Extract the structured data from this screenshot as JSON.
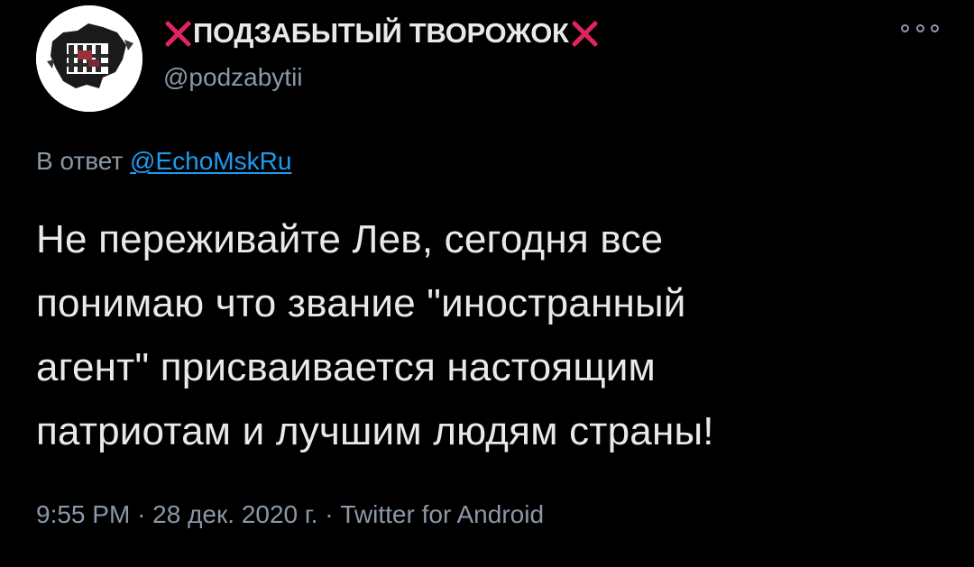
{
  "author": {
    "display_name": "ПОДЗАБЫТЫЙ ТВОРОЖОК",
    "decoration_icon": "cross-mark-icon",
    "decoration_color": "#e0245e",
    "handle": "@podzabytii"
  },
  "reply": {
    "prefix": "В ответ",
    "mention": "@EchoMskRu"
  },
  "tweet": {
    "lines": [
      "Не переживайте Лев, сегодня все",
      "понимаю что звание \"иностранный",
      "агент\" присваивается настоящим",
      "патриотам и лучшим людям страны!"
    ]
  },
  "meta": {
    "time": "9:55 PM",
    "date": "28 дек. 2020 г.",
    "source": "Twitter for Android",
    "separator": "·"
  },
  "colors": {
    "background": "#000000",
    "text": "#e7e9ea",
    "secondary": "#8b98a5",
    "link": "#1d9bf0"
  }
}
